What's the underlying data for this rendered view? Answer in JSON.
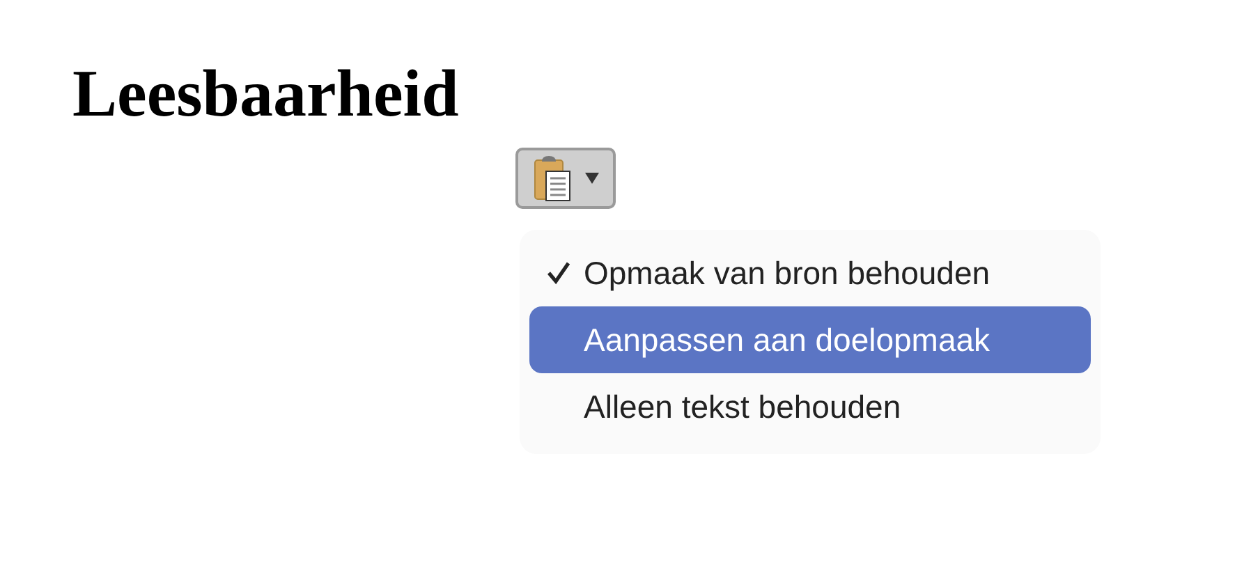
{
  "heading": "Leesbaarheid",
  "paste_menu": {
    "items": [
      {
        "label": "Opmaak van bron behouden",
        "checked": true,
        "selected": false
      },
      {
        "label": "Aanpassen aan doelopmaak",
        "checked": false,
        "selected": true
      },
      {
        "label": "Alleen tekst behouden",
        "checked": false,
        "selected": false
      }
    ]
  }
}
